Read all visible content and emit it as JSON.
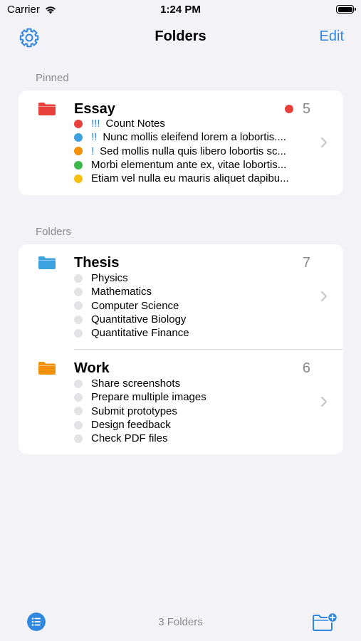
{
  "status_bar": {
    "carrier": "Carrier",
    "time": "1:24 PM"
  },
  "nav": {
    "title": "Folders",
    "edit_label": "Edit",
    "settings_icon": "gear-icon"
  },
  "colors": {
    "accent": "#2f87e0",
    "red": "#e8403a",
    "blue": "#3ba1df",
    "orange": "#f0900b",
    "green": "#3cb94a",
    "yellow": "#f7c00e",
    "gray_dot": "#e3e3e6"
  },
  "pinned": {
    "header": "Pinned",
    "folder": {
      "name": "Essay",
      "count": "5",
      "color": "#e8403a",
      "notes": [
        {
          "priority": "!!!",
          "text": "Count Notes",
          "color": "#e8403a"
        },
        {
          "priority": "!!",
          "text": "Nunc mollis eleifend lorem a lobortis....",
          "color": "#3ba1df"
        },
        {
          "priority": "!",
          "text": "Sed mollis nulla quis libero lobortis sc...",
          "color": "#f0900b"
        },
        {
          "priority": "",
          "text": "Morbi elementum ante ex, vitae lobortis...",
          "color": "#3cb94a"
        },
        {
          "priority": "",
          "text": "Etiam vel nulla eu mauris aliquet dapibu...",
          "color": "#f7c00e"
        }
      ]
    }
  },
  "folders": {
    "header": "Folders",
    "items": [
      {
        "name": "Thesis",
        "count": "7",
        "color": "#3ba1df",
        "notes": [
          "Physics",
          "Mathematics",
          "Computer Science",
          "Quantitative Biology",
          "Quantitative Finance"
        ]
      },
      {
        "name": "Work",
        "count": "6",
        "color": "#f0900b",
        "notes": [
          "Share screenshots",
          "Prepare multiple images",
          "Submit prototypes",
          "Design feedback",
          "Check PDF files"
        ]
      }
    ]
  },
  "footer": {
    "count_text": "3 Folders",
    "list_icon": "list-icon",
    "new_folder_icon": "folder-plus-icon"
  }
}
